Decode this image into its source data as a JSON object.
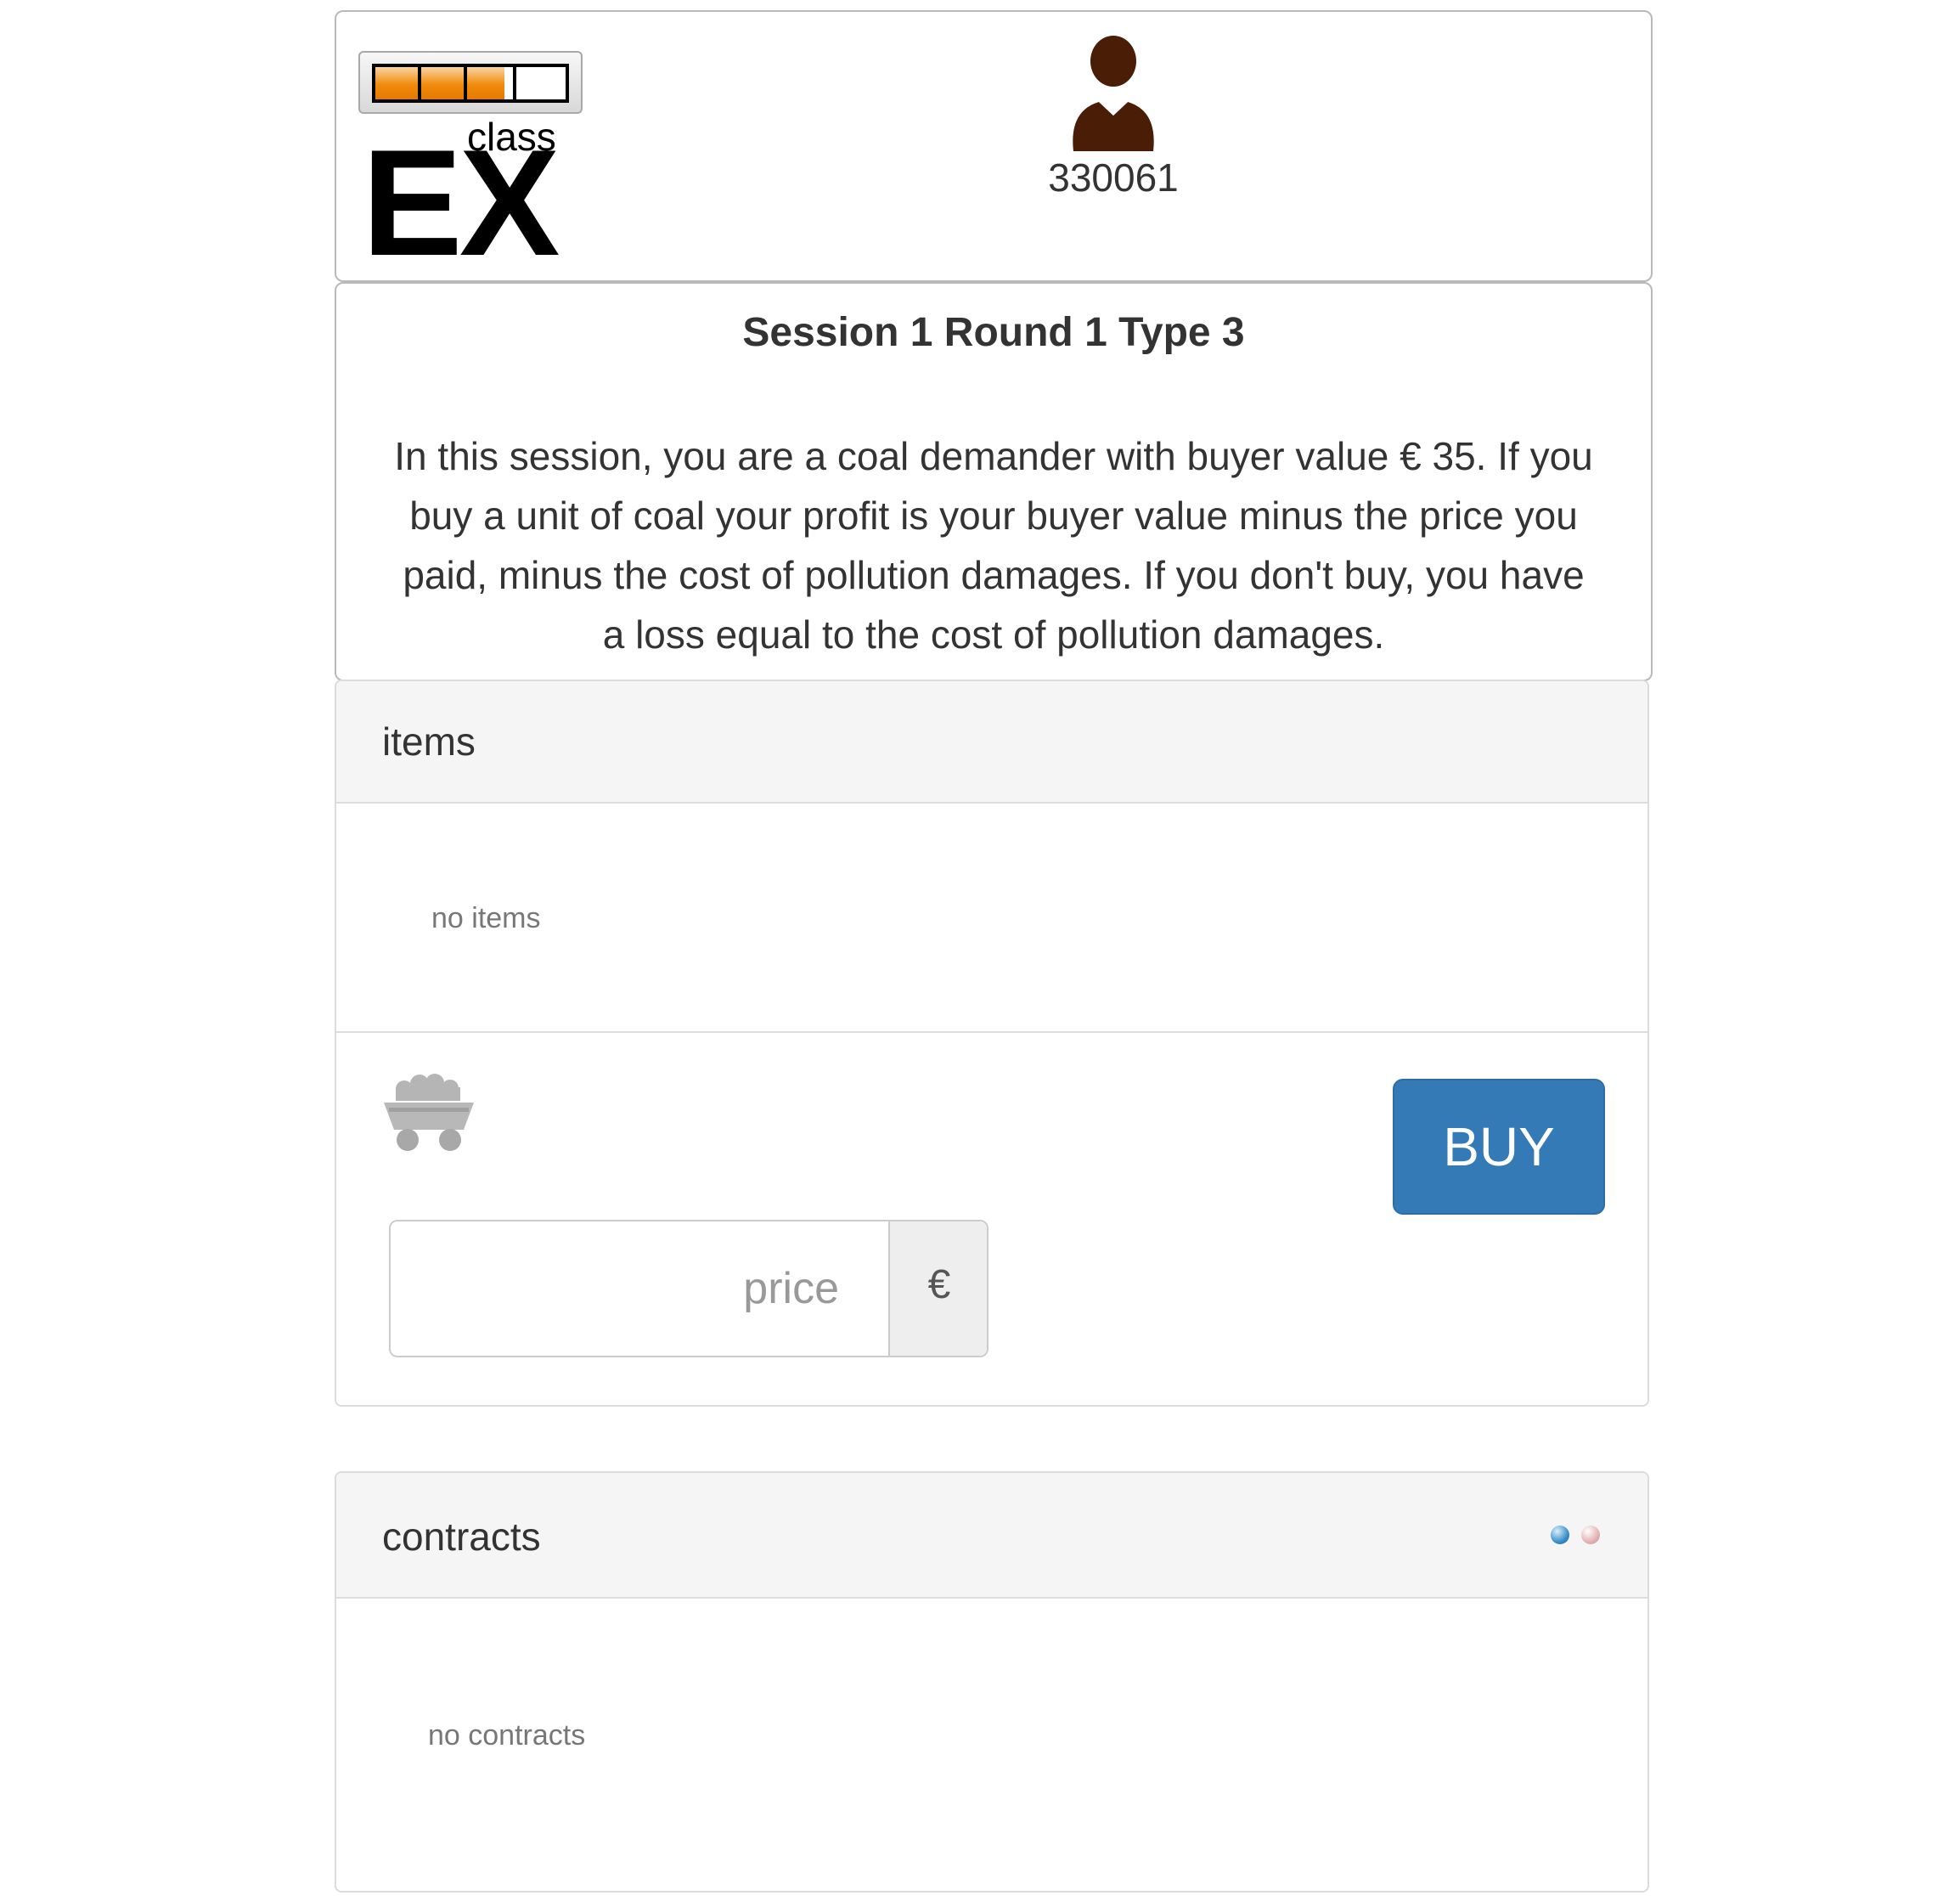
{
  "header": {
    "logo": {
      "small_text": "class",
      "big_text": "EX",
      "progress_fraction": 0.68
    },
    "user": {
      "icon": "user-icon",
      "id": "330061"
    }
  },
  "instructions": {
    "title": "Session 1 Round 1 Type 3",
    "text": "In this session, you are a coal demander with buyer value € 35. If you buy a unit of coal your profit is your buyer value minus the price you paid, minus the cost of pollution damages. If you don't buy, you have a loss equal to the cost of pollution damages."
  },
  "items": {
    "heading": "items",
    "empty_text": "no items",
    "cart_icon": "coal-cart-icon",
    "buy_label": "BUY",
    "price_placeholder": "price",
    "price_value": "",
    "currency_symbol": "€"
  },
  "contracts": {
    "heading": "contracts",
    "empty_text": "no contracts",
    "status_dots": [
      {
        "icon": "status-dot-blue",
        "color": "#3d8fc9"
      },
      {
        "icon": "status-dot-pink",
        "color": "#e2b3b3"
      }
    ]
  },
  "colors": {
    "primary_button": "#337ab7",
    "progress_orange": "#f08a0c",
    "user_icon": "#4a1e06"
  }
}
